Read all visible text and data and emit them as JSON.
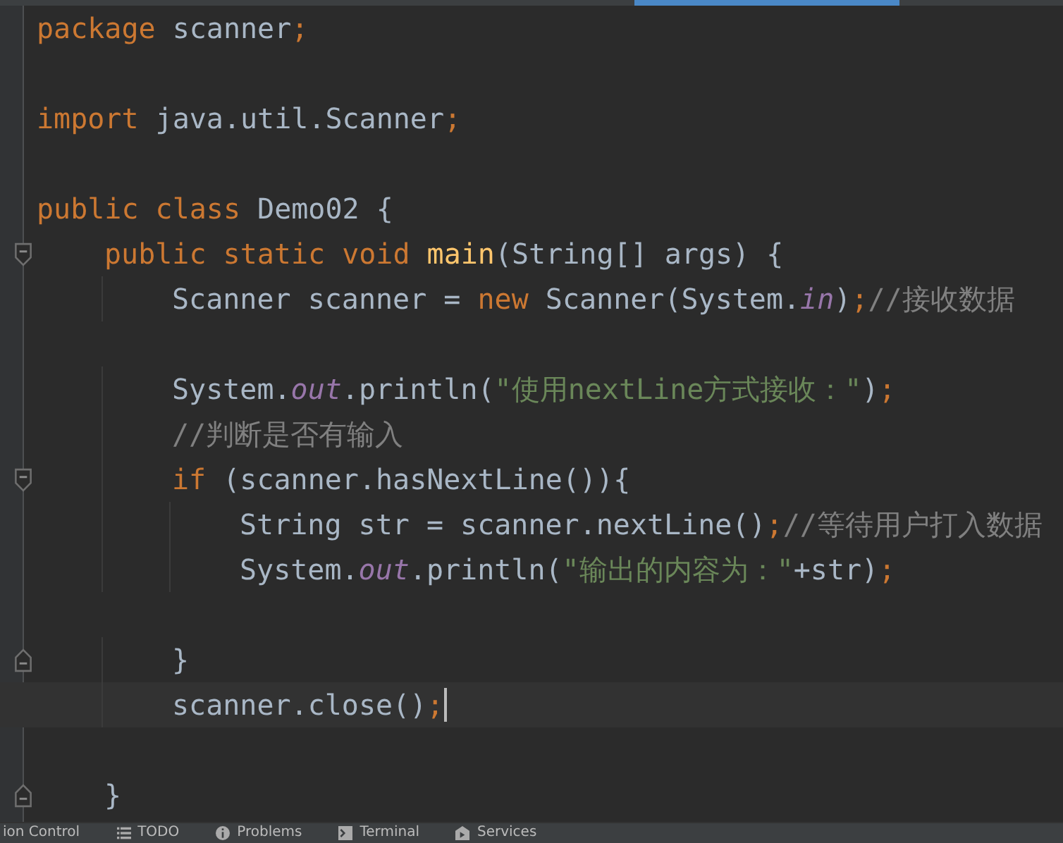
{
  "code_lines": [
    {
      "kind": "plain",
      "tokens": [
        {
          "kind": "keyword",
          "text": "package "
        },
        {
          "kind": "plain",
          "text": "scanner"
        },
        {
          "kind": "keyword",
          "text": ";"
        }
      ]
    },
    {
      "kind": "plain"
    },
    {
      "kind": "plain",
      "tokens": [
        {
          "kind": "keyword",
          "text": "import "
        },
        {
          "kind": "plain",
          "text": "java.util.Scanner"
        },
        {
          "kind": "keyword",
          "text": ";"
        }
      ]
    },
    {
      "kind": "plain"
    },
    {
      "kind": "plain",
      "tokens": [
        {
          "kind": "keyword",
          "text": "public class "
        },
        {
          "kind": "plain",
          "text": "Demo02 {"
        }
      ],
      "children": [
        {
          "kind": "fold_start",
          "tokens": [
            {
              "kind": "keyword",
              "text": "public static void "
            },
            {
              "kind": "declaration",
              "text": "main"
            },
            {
              "kind": "plain",
              "text": "(String[] args) {"
            }
          ],
          "children": [
            {
              "kind": "plain",
              "tokens": [
                {
                  "kind": "plain",
                  "text": "Scanner scanner = "
                },
                {
                  "kind": "keyword",
                  "text": "new "
                },
                {
                  "kind": "plain",
                  "text": "Scanner(System."
                },
                {
                  "kind": "field",
                  "text": "in"
                },
                {
                  "kind": "plain",
                  "text": ")"
                },
                {
                  "kind": "keyword",
                  "text": ";"
                },
                {
                  "kind": "comment",
                  "text": "//接收数据"
                }
              ]
            },
            {
              "kind": "plain"
            },
            {
              "kind": "plain",
              "tokens": [
                {
                  "kind": "plain",
                  "text": "System."
                },
                {
                  "kind": "field",
                  "text": "out"
                },
                {
                  "kind": "plain",
                  "text": ".println("
                },
                {
                  "kind": "string",
                  "text": "\"使用nextLine方式接收：\""
                },
                {
                  "kind": "plain",
                  "text": ")"
                },
                {
                  "kind": "keyword",
                  "text": ";"
                }
              ]
            },
            {
              "kind": "plain",
              "tokens": [
                {
                  "kind": "comment",
                  "text": "//判断是否有输入"
                }
              ]
            },
            {
              "kind": "fold_start",
              "tokens": [
                {
                  "kind": "keyword",
                  "text": "if "
                },
                {
                  "kind": "plain",
                  "text": "(scanner.hasNextLine()){"
                }
              ],
              "children": [
                {
                  "kind": "plain",
                  "tokens": [
                    {
                      "kind": "plain",
                      "text": "String str = scanner.nextLine()"
                    },
                    {
                      "kind": "keyword",
                      "text": ";"
                    },
                    {
                      "kind": "comment",
                      "text": "//等待用户打入数据"
                    }
                  ]
                },
                {
                  "kind": "plain",
                  "tokens": [
                    {
                      "kind": "plain",
                      "text": "System."
                    },
                    {
                      "kind": "field",
                      "text": "out"
                    },
                    {
                      "kind": "plain",
                      "text": ".println("
                    },
                    {
                      "kind": "string",
                      "text": "\"输出的内容为：\""
                    },
                    {
                      "kind": "plain",
                      "text": "+str)"
                    },
                    {
                      "kind": "keyword",
                      "text": ";"
                    }
                  ]
                },
                {
                  "kind": "plain"
                }
              ]
            },
            {
              "kind": "fold_end",
              "tokens": [
                {
                  "kind": "plain",
                  "text": "}"
                }
              ]
            },
            {
              "kind": "plain",
              "current": true,
              "tokens": [
                {
                  "kind": "plain",
                  "text": "scanner.close()"
                },
                {
                  "kind": "keyword",
                  "text": ";"
                }
              ]
            },
            {
              "kind": "plain"
            }
          ]
        },
        {
          "kind": "fold_end",
          "tokens": [
            {
              "kind": "plain",
              "text": "}"
            }
          ]
        }
      ]
    }
  ],
  "tool_windows": [
    {
      "kind": "text",
      "label": "ion Control"
    },
    {
      "kind": "list",
      "label": "TODO"
    },
    {
      "kind": "info",
      "label": "Problems"
    },
    {
      "kind": "terminal",
      "label": "Terminal"
    },
    {
      "kind": "services",
      "label": "Services"
    }
  ]
}
